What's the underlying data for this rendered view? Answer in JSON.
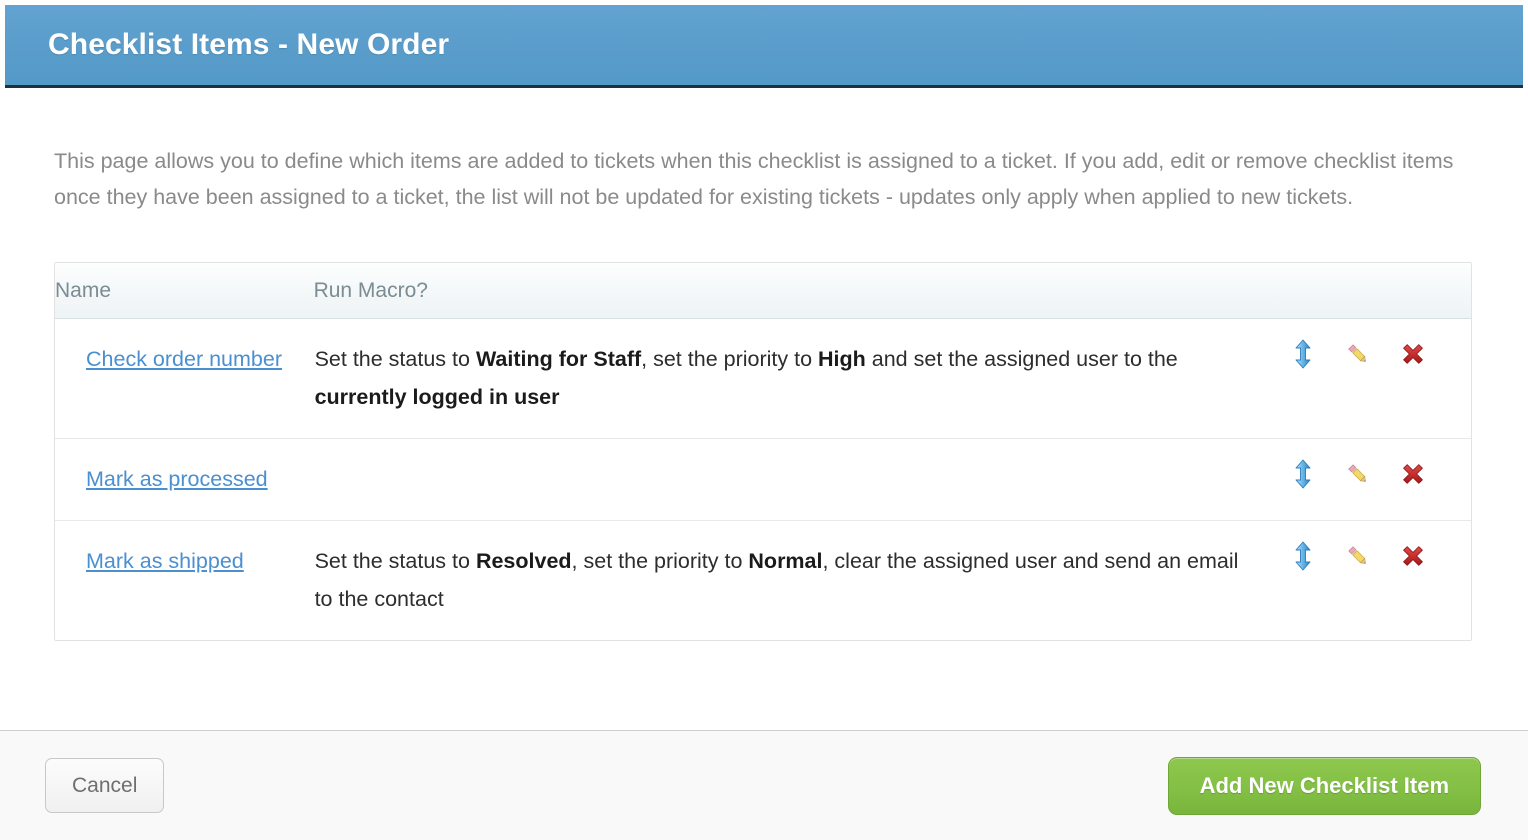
{
  "header": {
    "title": "Checklist Items - New Order",
    "background_color": "#559bca",
    "text_color": "#ffffff"
  },
  "intro": {
    "text": "This page allows you to define which items are added to tickets when this checklist is assigned to a ticket. If you add, edit or remove checklist items once they have been assigned to a ticket, the list will not be updated for existing tickets - updates only apply when applied to new tickets."
  },
  "table": {
    "columns": [
      "Name",
      "Run Macro?",
      ""
    ],
    "rows": [
      {
        "name": "Check order number",
        "macro_html": "Set the status to <b>Waiting for Staff</b>, set the priority to <b>High</b> and set the assigned user to the <b>currently logged in user</b>",
        "macro_text": "Set the status to Waiting for Staff, set the priority to High and set the assigned user to the currently logged in user",
        "actions": [
          "reorder-icon",
          "edit-icon",
          "delete-icon"
        ]
      },
      {
        "name": "Mark as processed",
        "macro_html": "",
        "macro_text": "",
        "actions": [
          "reorder-icon",
          "edit-icon",
          "delete-icon"
        ]
      },
      {
        "name": "Mark as shipped",
        "macro_html": "Set the status to <b>Resolved</b>, set the priority to <b>Normal</b>, clear the assigned user and send an email to the contact",
        "macro_text": "Set the status to Resolved, set the priority to Normal, clear the assigned user and send an email to the contact",
        "actions": [
          "reorder-icon",
          "edit-icon",
          "delete-icon"
        ]
      }
    ]
  },
  "footer": {
    "cancel_label": "Cancel",
    "add_label": "Add New Checklist Item",
    "add_color": "#83c045"
  },
  "colors": {
    "link": "#4a8fd0",
    "muted_text": "#8a8a8a",
    "table_header_text": "#7b8c94",
    "delete_icon": "#c22020",
    "reorder_icon": "#4c9fe0",
    "edit_icon": "#f2d24b"
  }
}
